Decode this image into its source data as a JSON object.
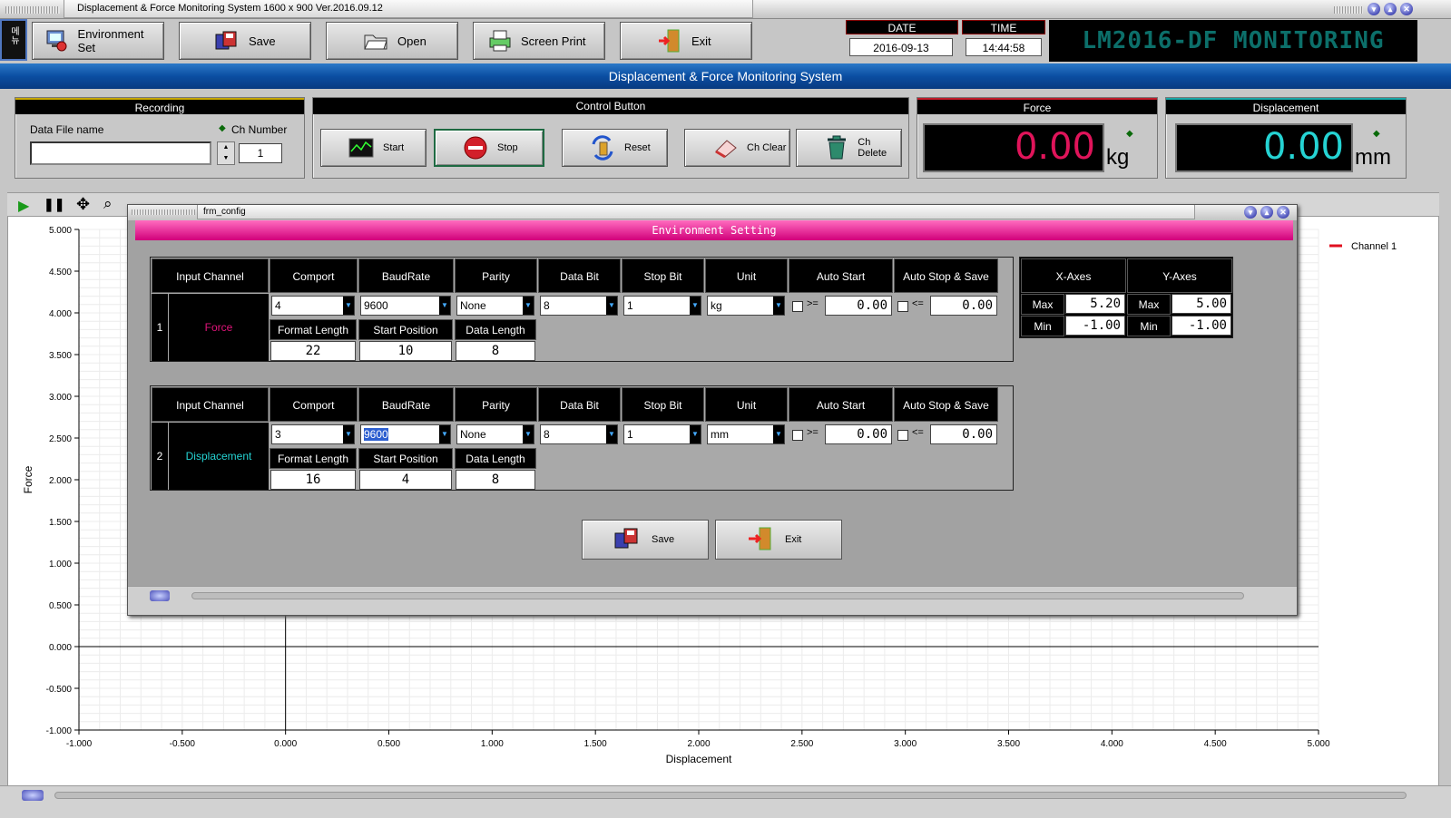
{
  "window": {
    "title": "Displacement  & Force Monitoring System 1600 x 900  Ver.2016.09.12",
    "side_label": "메뉴"
  },
  "toolbar": {
    "environment_set": "Environment Set",
    "save": "Save",
    "open": "Open",
    "screen_print": "Screen Print",
    "exit": "Exit"
  },
  "datetime": {
    "date_label": "DATE",
    "date": "2016-09-13",
    "time_label": "TIME",
    "time": "14:44:58"
  },
  "brand": "LM2016-DF MONITORING",
  "subtitle": "Displacement  &  Force  Monitoring  System",
  "recording": {
    "title": "Recording",
    "file_label": "Data File name",
    "file_value": "",
    "ch_label": "Ch Number",
    "ch_value": "1"
  },
  "control": {
    "title": "Control Button",
    "start": "Start",
    "stop": "Stop",
    "reset": "Reset",
    "ch_clear": "Ch Clear",
    "ch_delete": "Ch Delete"
  },
  "force": {
    "title": "Force",
    "value": "0.00",
    "unit": "kg"
  },
  "displacement": {
    "title": "Displacement",
    "value": "0.00",
    "unit": "mm"
  },
  "colors": {
    "force_value": "#e0145a",
    "disp_value": "#25d3d3",
    "accent_blue": "#0b4ea2",
    "dialog_head": "#d1007a"
  },
  "chart_data": {
    "type": "line",
    "xlabel": "Displacement",
    "ylabel": "Force",
    "xlim": [
      -1.0,
      5.2
    ],
    "ylim": [
      -1.0,
      5.0
    ],
    "x_ticks": [
      "-1.000",
      "-0.500",
      "0.000",
      "0.500",
      "1.000",
      "1.500",
      "2.000",
      "2.500",
      "3.000",
      "3.500",
      "4.000",
      "4.500",
      "5.000"
    ],
    "y_ticks": [
      "5.000",
      "4.500",
      "4.000",
      "3.500",
      "3.000",
      "2.500",
      "2.000",
      "1.500",
      "1.000",
      "0.500",
      "0.000",
      "-0.500",
      "-1.000"
    ],
    "series": [
      {
        "name": "Channel 1",
        "values": []
      }
    ],
    "legend": "top-right",
    "grid": true
  },
  "dialog": {
    "window_title": "frm_config",
    "header": "Environment Setting",
    "columns": [
      "Input Channel",
      "Comport",
      "BaudRate",
      "Parity",
      "Data Bit",
      "Stop Bit",
      "Unit",
      "Auto Start",
      "Auto Stop  &  Save"
    ],
    "sub_columns": [
      "Format Length",
      "Start Position",
      "Data Length"
    ],
    "channels": [
      {
        "no": "1",
        "name": "Force",
        "comport": "4",
        "baud": "9600",
        "parity": "None",
        "databit": "8",
        "stopbit": "1",
        "unit": "kg",
        "start_op": ">=",
        "start_val": "0.00",
        "stop_op": "<=",
        "stop_val": "0.00",
        "format_length": "22",
        "start_position": "10",
        "data_length": "8"
      },
      {
        "no": "2",
        "name": "Displacement",
        "comport": "3",
        "baud": "9600",
        "parity": "None",
        "databit": "8",
        "stopbit": "1",
        "unit": "mm",
        "start_op": ">=",
        "start_val": "0.00",
        "stop_op": "<=",
        "stop_val": "0.00",
        "format_length": "16",
        "start_position": "4",
        "data_length": "8"
      }
    ],
    "axes": {
      "x_label": "X-Axes",
      "y_label": "Y-Axes",
      "max_label": "Max",
      "min_label": "Min",
      "x_max": "5.20",
      "x_min": "-1.00",
      "y_max": "5.00",
      "y_min": "-1.00"
    },
    "save": "Save",
    "exit": "Exit"
  }
}
